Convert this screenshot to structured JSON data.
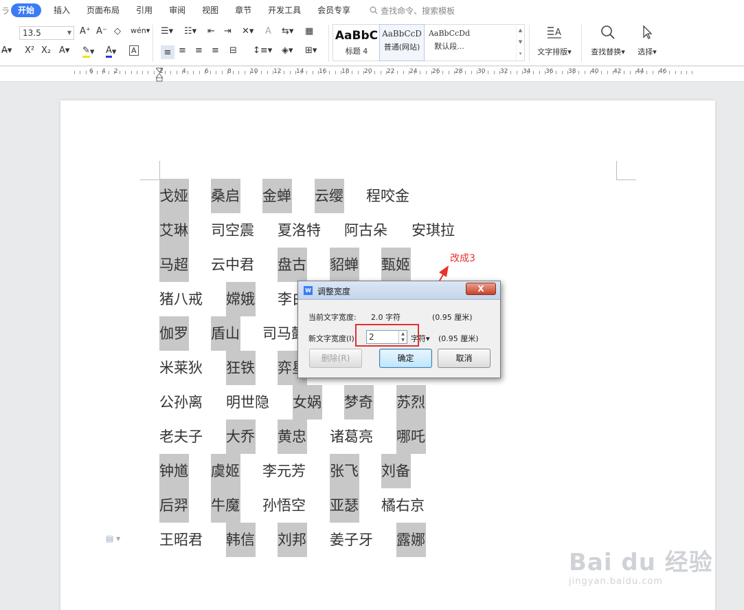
{
  "menubar": {
    "edge": "ラ",
    "tabs": [
      "开始",
      "插入",
      "页面布局",
      "引用",
      "审阅",
      "视图",
      "章节",
      "开发工具",
      "会员专享"
    ],
    "active_tab": "开始",
    "search_placeholder": "查找命令、搜索模板"
  },
  "toolbar": {
    "font_size": "13.5",
    "styles": [
      {
        "sample": "AaBbC",
        "name": "标题 4"
      },
      {
        "sample": "AaBbCcD",
        "name": "普通(网站)"
      },
      {
        "sample": "AaBbCcDd",
        "name": "默认段..."
      }
    ],
    "text_layout_label": "文字排版",
    "find_replace_label": "查找替换",
    "select_label": "选择"
  },
  "ruler": {
    "numbers": [
      "6",
      "4",
      "2",
      "2",
      "4",
      "6",
      "8",
      "10",
      "12",
      "14",
      "16",
      "18",
      "20",
      "22",
      "24",
      "26",
      "28",
      "30",
      "32",
      "34",
      "36",
      "38",
      "40",
      "42",
      "44",
      "46"
    ]
  },
  "document": {
    "rows": [
      [
        {
          "t": "戈娅",
          "h": true
        },
        {
          "t": "桑启",
          "h": true
        },
        {
          "t": "金蝉",
          "h": true
        },
        {
          "t": "云缨",
          "h": true
        },
        {
          "t": "程咬金",
          "h": false
        }
      ],
      [
        {
          "t": "艾琳",
          "h": true
        },
        {
          "t": "司空震",
          "h": false
        },
        {
          "t": "夏洛特",
          "h": false
        },
        {
          "t": "阿古朵",
          "h": false
        },
        {
          "t": "安琪拉",
          "h": false
        }
      ],
      [
        {
          "t": "马超",
          "h": true
        },
        {
          "t": "云中君",
          "h": false
        },
        {
          "t": "盘古",
          "h": true
        },
        {
          "t": "貂蝉",
          "h": true
        },
        {
          "t": "甄姬",
          "h": true
        }
      ],
      [
        {
          "t": "猪八戒",
          "h": false
        },
        {
          "t": "嫦娥",
          "h": true
        },
        {
          "t": "李白",
          "h": false
        }
      ],
      [
        {
          "t": "伽罗",
          "h": true
        },
        {
          "t": "盾山",
          "h": true
        },
        {
          "t": "司马懿",
          "h": false
        }
      ],
      [
        {
          "t": "米莱狄",
          "h": false
        },
        {
          "t": "狂铁",
          "h": true
        },
        {
          "t": "弈星",
          "h": true
        }
      ],
      [
        {
          "t": "公孙离",
          "h": false
        },
        {
          "t": "明世隐",
          "h": false
        },
        {
          "t": "女娲",
          "h": true
        },
        {
          "t": "梦奇",
          "h": true
        },
        {
          "t": "苏烈",
          "h": true
        }
      ],
      [
        {
          "t": "老夫子",
          "h": false
        },
        {
          "t": "大乔",
          "h": true
        },
        {
          "t": "黄忠",
          "h": true
        },
        {
          "t": "诸葛亮",
          "h": false
        },
        {
          "t": "哪吒",
          "h": true
        }
      ],
      [
        {
          "t": "钟馗",
          "h": true
        },
        {
          "t": "虞姬",
          "h": true
        },
        {
          "t": "李元芳",
          "h": false
        },
        {
          "t": "张飞",
          "h": true
        },
        {
          "t": "刘备",
          "h": true
        }
      ],
      [
        {
          "t": "后羿",
          "h": true
        },
        {
          "t": "牛魔",
          "h": true
        },
        {
          "t": "孙悟空",
          "h": false
        },
        {
          "t": "亚瑟",
          "h": true
        },
        {
          "t": "橘右京",
          "h": false
        }
      ],
      [
        {
          "t": "王昭君",
          "h": false
        },
        {
          "t": "韩信",
          "h": true
        },
        {
          "t": "刘邦",
          "h": true
        },
        {
          "t": "姜子牙",
          "h": false
        },
        {
          "t": "露娜",
          "h": true
        }
      ]
    ]
  },
  "annotation": {
    "label": "改成3",
    "color": "#e8322e"
  },
  "dialog": {
    "title": "调整宽度",
    "close": "X",
    "current_label": "当前文字宽度:",
    "current_value": "2.0 字符",
    "current_cm": "(0.95 厘米)",
    "new_label": "新文字宽度(I):",
    "new_value": "2",
    "unit": "字符",
    "new_cm": "(0.95 厘米)",
    "delete_btn": "删除(R)",
    "ok_btn": "确定",
    "cancel_btn": "取消"
  },
  "watermark": {
    "brand": "Bai du 经验",
    "url": "jingyan.baidu.com"
  }
}
